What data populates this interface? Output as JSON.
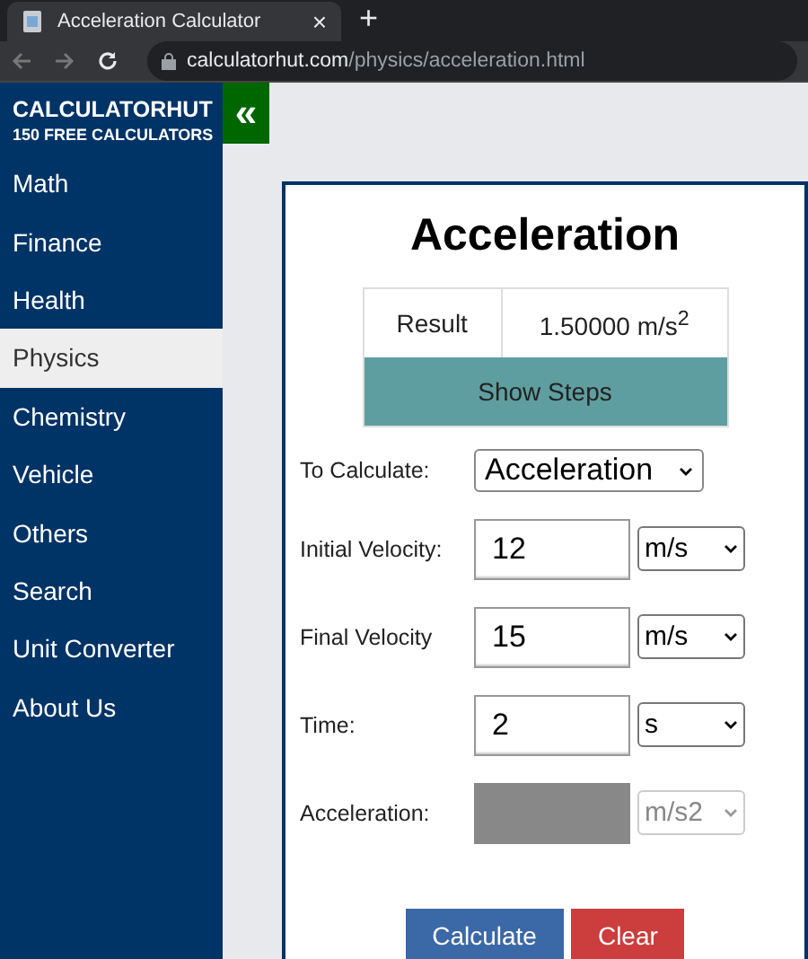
{
  "browser": {
    "tab_title": "Acceleration Calculator",
    "tab_close": "×",
    "new_tab": "+",
    "url_host": "calculatorhut.com",
    "url_path": "/physics/acceleration.html"
  },
  "sidebar": {
    "brand": "CALCULATORHUT",
    "tagline": "150 FREE CALCULATORS",
    "toggle": "«",
    "items": [
      {
        "label": "Math",
        "selected": false
      },
      {
        "label": "Finance",
        "selected": false
      },
      {
        "label": "Health",
        "selected": false
      },
      {
        "label": "Physics",
        "selected": true
      },
      {
        "label": "Chemistry",
        "selected": false
      },
      {
        "label": "Vehicle",
        "selected": false
      },
      {
        "label": "Others",
        "selected": false
      },
      {
        "label": "Search",
        "selected": false
      },
      {
        "label": "Unit Converter",
        "selected": false
      },
      {
        "label": "About Us",
        "selected": false
      }
    ]
  },
  "calculator": {
    "title": "Acceleration",
    "result_label": "Result",
    "result_value": "1.50000 m/s$^{2}$",
    "show_steps": "Show Steps",
    "to_calculate_label": "To Calculate:",
    "to_calculate_value": "Acceleration",
    "fields": [
      {
        "label": "Initial Velocity:",
        "value": "12",
        "unit": "m/s",
        "disabled": false
      },
      {
        "label": "Final Velocity",
        "value": "15",
        "unit": "m/s",
        "disabled": false
      },
      {
        "label": "Time:",
        "value": "2",
        "unit": "s",
        "disabled": false
      },
      {
        "label": "Acceleration:",
        "unit": "m/s2",
        "disabled": true
      }
    ],
    "buttons": [
      {
        "label": "Calculate",
        "kind": "primary"
      },
      {
        "label": "Clear",
        "kind": "danger"
      }
    ]
  }
}
